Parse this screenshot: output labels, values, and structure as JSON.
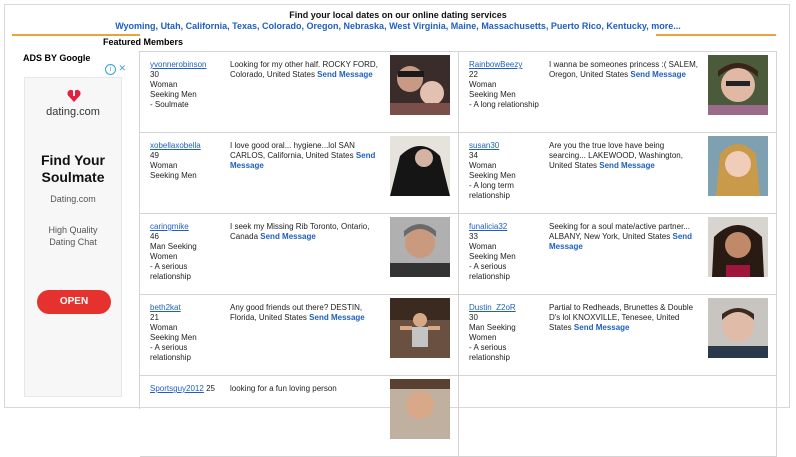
{
  "header": {
    "heading": "Find your local dates on our online dating services",
    "states": [
      "Wyoming",
      "Utah",
      "California",
      "Texas",
      "Colorado",
      "Oregon",
      "Nebraska",
      "West Virginia",
      "Maine",
      "Massachusetts",
      "Puerto Rico",
      "Kentucky",
      "more..."
    ]
  },
  "featured_title": "Featured Members",
  "ads": {
    "title": "ADS BY Google",
    "brand": "dating.com",
    "headline_line1": "Find Your",
    "headline_line2": "Soulmate",
    "domain": "Dating.com",
    "desc_line1": "High Quality",
    "desc_line2": "Dating Chat",
    "cta": "OPEN"
  },
  "members": [
    {
      "username": "yvonnerobinson",
      "age": "30",
      "line1": "Woman",
      "line2": "Seeking Men",
      "line3": "- Soulmate",
      "message": "Looking for my other half. ROCKY FORD, Colorado, United States",
      "send": "Send Message"
    },
    {
      "username": "RainbowBeezy",
      "age": "22",
      "line1": "Woman",
      "line2": "Seeking Men",
      "line3": "- A long relationship",
      "message": "I wanna be someones princess :( SALEM, Oregon, United States",
      "send": "Send Message"
    },
    {
      "username": "xobellaxobella",
      "age": "49",
      "line1": "Woman",
      "line2": "Seeking Men",
      "line3": "",
      "message": "I love good oral... hygiene...lol SAN CARLOS, California, United States",
      "send": "Send Message"
    },
    {
      "username": "susan30",
      "age": "34",
      "line1": "Woman",
      "line2": "Seeking Men",
      "line3": "- A long term relationship",
      "message": "Are you the true love have being searcing... LAKEWOOD, Washington, United States",
      "send": "Send Message"
    },
    {
      "username": "caringmike",
      "age": "46",
      "line1": "Man Seeking",
      "line2": "Women",
      "line3": "- A serious relationship",
      "message": "I seek my Missing Rib Toronto, Ontario, Canada",
      "send": "Send Message"
    },
    {
      "username": "funalicia32",
      "age": "33",
      "line1": "Woman",
      "line2": "Seeking Men",
      "line3": "- A serious relationship",
      "message": "Seeking for a soul mate/active partner... ALBANY, New York, United States",
      "send": "Send Message"
    },
    {
      "username": "beth2kat",
      "age": "21",
      "line1": "Woman",
      "line2": "Seeking Men",
      "line3": "- A serious relationship",
      "message": "Any good friends out there? DESTIN, Florida, United States",
      "send": "Send Message"
    },
    {
      "username": "Dustin_Z2oR",
      "age": "30",
      "line1": "Man Seeking",
      "line2": "Women",
      "line3": "- A serious relationship",
      "message": "Partial to Redheads, Brunettes & Double D's lol KNOXVILLE, Tenesee, United States",
      "send": "Send Message"
    },
    {
      "username": "Sportsguy2012",
      "age": "25",
      "line1": "",
      "line2": "",
      "line3": "",
      "message": "looking for a fun loving person",
      "send": ""
    }
  ]
}
